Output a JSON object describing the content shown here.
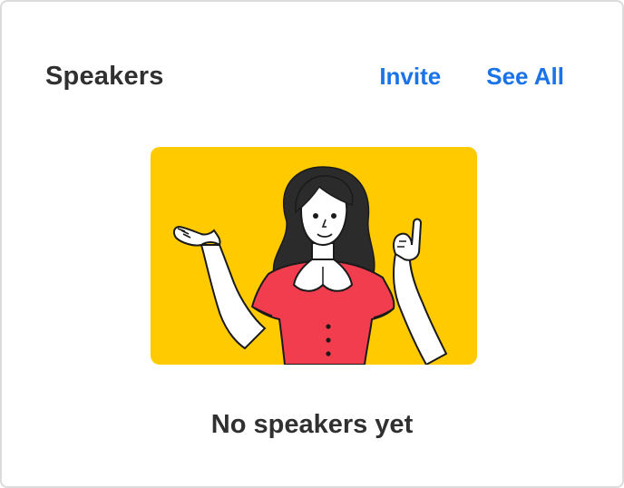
{
  "card": {
    "title": "Speakers",
    "invite_label": "Invite",
    "see_all_label": "See All",
    "empty_message": "No speakers yet"
  },
  "colors": {
    "accent": "#1a73e8",
    "illustration_bg": "#ffcb00",
    "dress": "#f23d4f",
    "text": "#303030"
  },
  "icons": {
    "illustration": "woman-waving-illustration"
  }
}
